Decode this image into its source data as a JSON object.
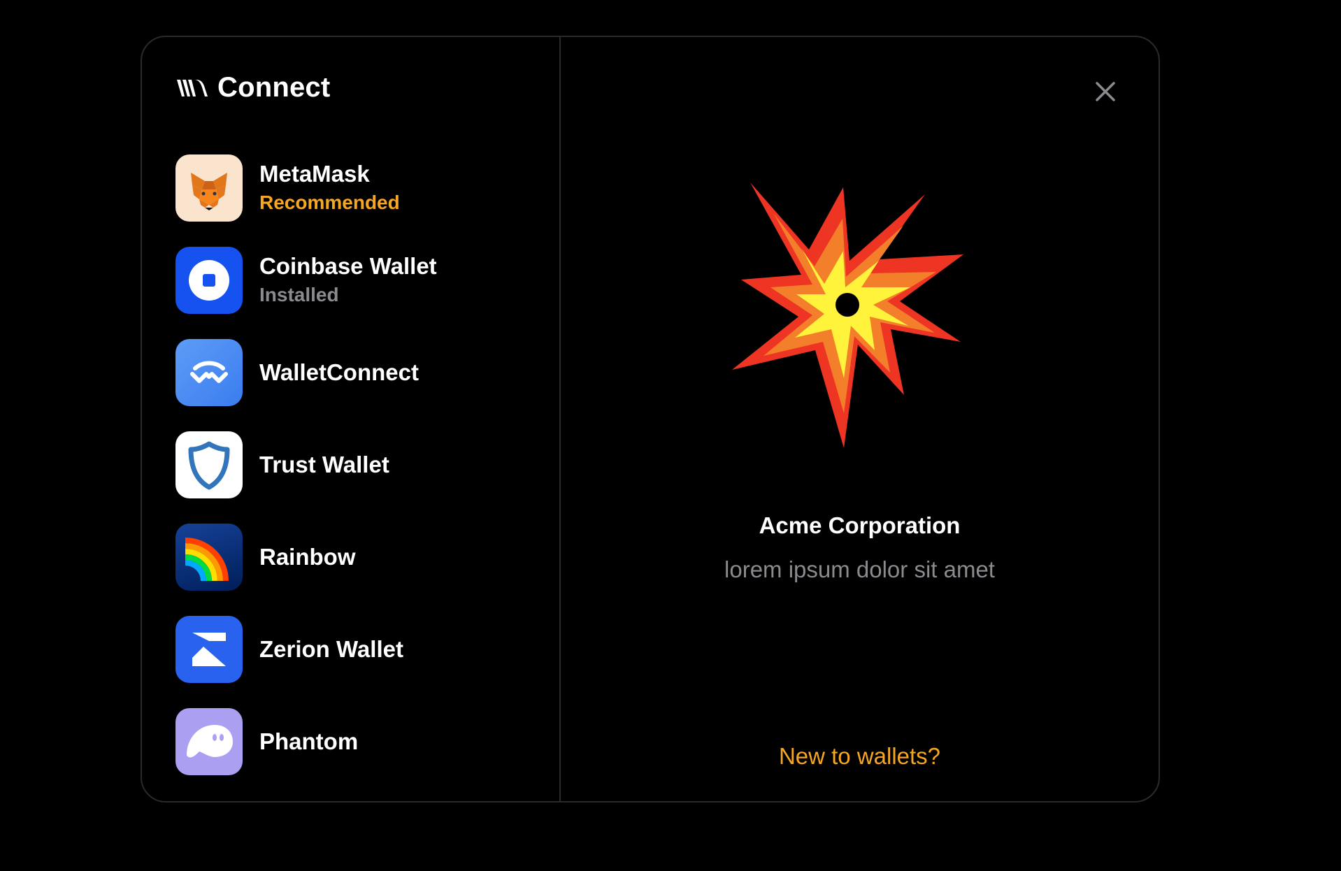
{
  "modal": {
    "title": "Connect",
    "brand_icon": "walletkit-logo-icon"
  },
  "wallets": [
    {
      "name": "MetaMask",
      "subtitle": "Recommended",
      "icon": "metamask-fox-icon"
    },
    {
      "name": "Coinbase Wallet",
      "subtitle": "Installed",
      "icon": "coinbase-icon"
    },
    {
      "name": "WalletConnect",
      "subtitle": "",
      "icon": "walletconnect-icon"
    },
    {
      "name": "Trust Wallet",
      "subtitle": "",
      "icon": "trust-shield-icon"
    },
    {
      "name": "Rainbow",
      "subtitle": "",
      "icon": "rainbow-icon"
    },
    {
      "name": "Zerion Wallet",
      "subtitle": "",
      "icon": "zerion-icon"
    },
    {
      "name": "Phantom",
      "subtitle": "",
      "icon": "phantom-ghost-icon"
    }
  ],
  "detail": {
    "illustration": "explosion-icon",
    "org_name": "Acme Corporation",
    "org_description": "lorem ipsum dolor sit amet",
    "new_to_wallets": "New to wallets?",
    "close_icon": "close-icon"
  },
  "colors": {
    "background": "#000000",
    "accent": "#f5a623",
    "muted": "#8a8a8f",
    "border": "#2a2a2a",
    "text": "#ffffff"
  }
}
